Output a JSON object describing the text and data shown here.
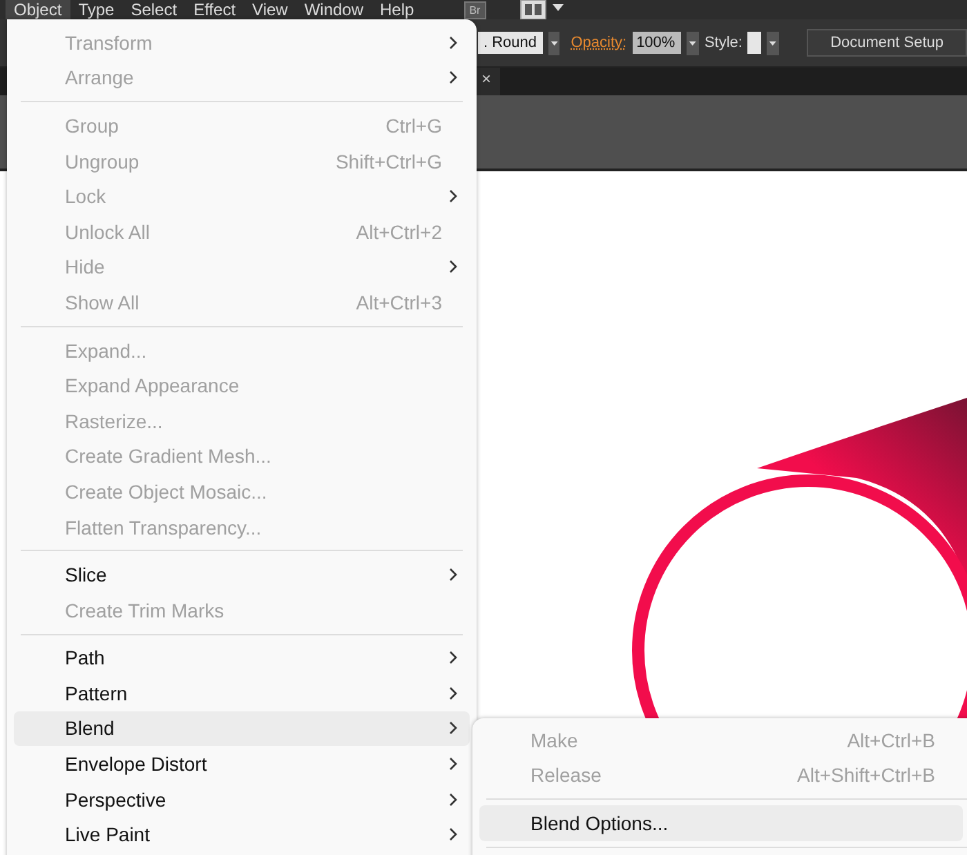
{
  "menu_bar": [
    {
      "label": "Object",
      "selected": true
    },
    {
      "label": "Type",
      "selected": false
    },
    {
      "label": "Select",
      "selected": false
    },
    {
      "label": "Effect",
      "selected": false
    },
    {
      "label": "View",
      "selected": false
    },
    {
      "label": "Window",
      "selected": false
    },
    {
      "label": "Help",
      "selected": false
    }
  ],
  "bridge_button": "Br",
  "control_bar": {
    "cap_dropdown": ". Round",
    "opacity_label": "Opacity:",
    "opacity_value": "100%",
    "style_label": "Style:",
    "document_setup": "Document Setup"
  },
  "tab": {
    "close": "×"
  },
  "menu": [
    {
      "kind": "item",
      "label": "Transform",
      "submenu": true,
      "disabled": true,
      "selected": false
    },
    {
      "kind": "item",
      "label": "Arrange",
      "submenu": true,
      "disabled": true,
      "selected": false
    },
    {
      "kind": "separator"
    },
    {
      "kind": "item",
      "label": "Group",
      "shortcut": "Ctrl+G",
      "submenu": false,
      "disabled": true,
      "selected": false
    },
    {
      "kind": "item",
      "label": "Ungroup",
      "shortcut": "Shift+Ctrl+G",
      "submenu": false,
      "disabled": true,
      "selected": false
    },
    {
      "kind": "item",
      "label": "Lock",
      "submenu": true,
      "disabled": true,
      "selected": false
    },
    {
      "kind": "item",
      "label": "Unlock All",
      "shortcut": "Alt+Ctrl+2",
      "submenu": false,
      "disabled": true,
      "selected": false
    },
    {
      "kind": "item",
      "label": "Hide",
      "submenu": true,
      "disabled": true,
      "selected": false
    },
    {
      "kind": "item",
      "label": "Show All",
      "shortcut": "Alt+Ctrl+3",
      "submenu": false,
      "disabled": true,
      "selected": false
    },
    {
      "kind": "separator"
    },
    {
      "kind": "item",
      "label": "Expand...",
      "submenu": false,
      "disabled": true,
      "selected": false
    },
    {
      "kind": "item",
      "label": "Expand Appearance",
      "submenu": false,
      "disabled": true,
      "selected": false
    },
    {
      "kind": "item",
      "label": "Rasterize...",
      "submenu": false,
      "disabled": true,
      "selected": false
    },
    {
      "kind": "item",
      "label": "Create Gradient Mesh...",
      "submenu": false,
      "disabled": true,
      "selected": false
    },
    {
      "kind": "item",
      "label": "Create Object Mosaic...",
      "submenu": false,
      "disabled": true,
      "selected": false
    },
    {
      "kind": "item",
      "label": "Flatten Transparency...",
      "submenu": false,
      "disabled": true,
      "selected": false
    },
    {
      "kind": "separator"
    },
    {
      "kind": "item",
      "label": "Slice",
      "submenu": true,
      "disabled": false,
      "selected": false
    },
    {
      "kind": "item",
      "label": "Create Trim Marks",
      "submenu": false,
      "disabled": true,
      "selected": false
    },
    {
      "kind": "separator"
    },
    {
      "kind": "item",
      "label": "Path",
      "submenu": true,
      "disabled": false,
      "selected": false
    },
    {
      "kind": "item",
      "label": "Pattern",
      "submenu": true,
      "disabled": false,
      "selected": false
    },
    {
      "kind": "item",
      "label": "Blend",
      "submenu": true,
      "disabled": false,
      "selected": true
    },
    {
      "kind": "item",
      "label": "Envelope Distort",
      "submenu": true,
      "disabled": false,
      "selected": false
    },
    {
      "kind": "item",
      "label": "Perspective",
      "submenu": true,
      "disabled": false,
      "selected": false
    },
    {
      "kind": "item",
      "label": "Live Paint",
      "submenu": true,
      "disabled": false,
      "selected": false
    }
  ],
  "submenu": [
    {
      "kind": "item",
      "label": "Make",
      "shortcut": "Alt+Ctrl+B",
      "submenu": false,
      "disabled": true,
      "selected": false
    },
    {
      "kind": "item",
      "label": "Release",
      "shortcut": "Alt+Shift+Ctrl+B",
      "submenu": false,
      "disabled": true,
      "selected": false
    },
    {
      "kind": "separator"
    },
    {
      "kind": "item",
      "label": "Blend Options...",
      "submenu": false,
      "disabled": false,
      "selected": true
    },
    {
      "kind": "separator"
    }
  ]
}
